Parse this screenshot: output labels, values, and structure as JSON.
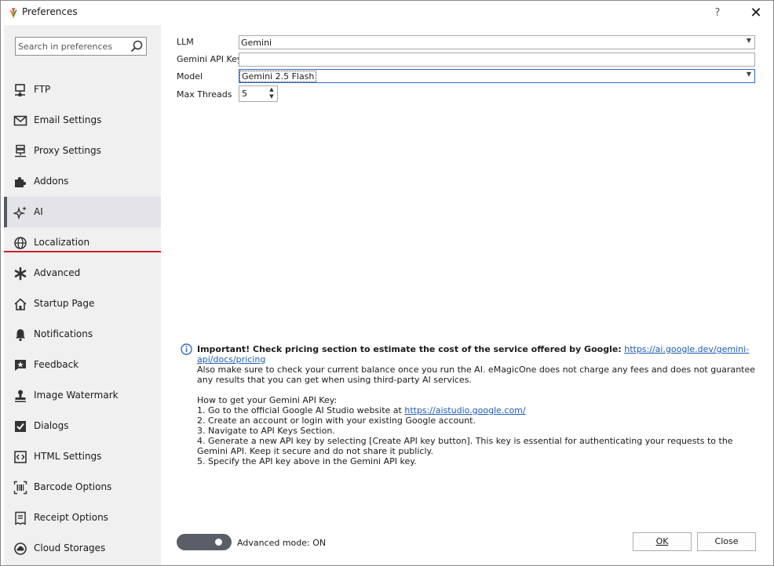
{
  "window": {
    "title": "Preferences",
    "help": "?",
    "close": "✕"
  },
  "sidebar": {
    "search_placeholder": "Search in preferences",
    "items": [
      {
        "label": "FTP",
        "icon": "ftp-icon"
      },
      {
        "label": "Email Settings",
        "icon": "envelope-icon"
      },
      {
        "label": "Proxy Settings",
        "icon": "proxy-icon"
      },
      {
        "label": "Addons",
        "icon": "puzzle-icon"
      },
      {
        "label": "AI",
        "icon": "sparkle-icon",
        "active": true
      },
      {
        "label": "Localization",
        "icon": "globe-icon"
      },
      {
        "label": "Advanced",
        "icon": "asterisk-icon"
      },
      {
        "label": "Startup Page",
        "icon": "home-icon"
      },
      {
        "label": "Notifications",
        "icon": "bell-icon"
      },
      {
        "label": "Feedback",
        "icon": "feedback-icon"
      },
      {
        "label": "Image Watermark",
        "icon": "stamp-icon"
      },
      {
        "label": "Dialogs",
        "icon": "check-box-icon"
      },
      {
        "label": "HTML Settings",
        "icon": "code-icon"
      },
      {
        "label": "Barcode Options",
        "icon": "barcode-icon"
      },
      {
        "label": "Receipt Options",
        "icon": "receipt-icon"
      },
      {
        "label": "Cloud Storages",
        "icon": "cloud-icon"
      }
    ]
  },
  "form": {
    "llm_label": "LLM",
    "llm_value": "Gemini",
    "api_key_label": "Gemini API Key",
    "api_key_value": "",
    "model_label": "Model",
    "model_value": "Gemini 2.5 Flash",
    "threads_label": "Max Threads",
    "threads_value": "5"
  },
  "info": {
    "important": "Important! Check pricing section to estimate the cost of the service offered by Google:",
    "pricing_link": "https://ai.google.dev/gemini-api/docs/pricing",
    "balance_note": "Also make sure to check your current balance once you run the AI. eMagicOne does not charge any fees and does not guarantee any results that you can get when using third-party AI services.",
    "howto_title": "How to get your Gemini API Key:",
    "step1": "1. Go to the official Google AI Studio website at",
    "studio_link": "https://aistudio.google.com/",
    "step2": "2. Create an account or login with your existing Google account.",
    "step3": "3. Navigate to API Keys Section.",
    "step4": "4. Generate a new API key by selecting [Create API key button]. This key is essential for authenticating your requests to the Gemini API. Keep it secure and do not share it publicly.",
    "step5": "5. Specify the API key above in the Gemini API key."
  },
  "footer": {
    "advanced_mode_label": "Advanced mode: ON",
    "ok_label": "OK",
    "close_label": "Close"
  },
  "colors": {
    "accent_underline": "#d0202a",
    "link": "#1c5db7",
    "info_icon": "#2e6bd1",
    "toggle": "#5a5e68"
  }
}
